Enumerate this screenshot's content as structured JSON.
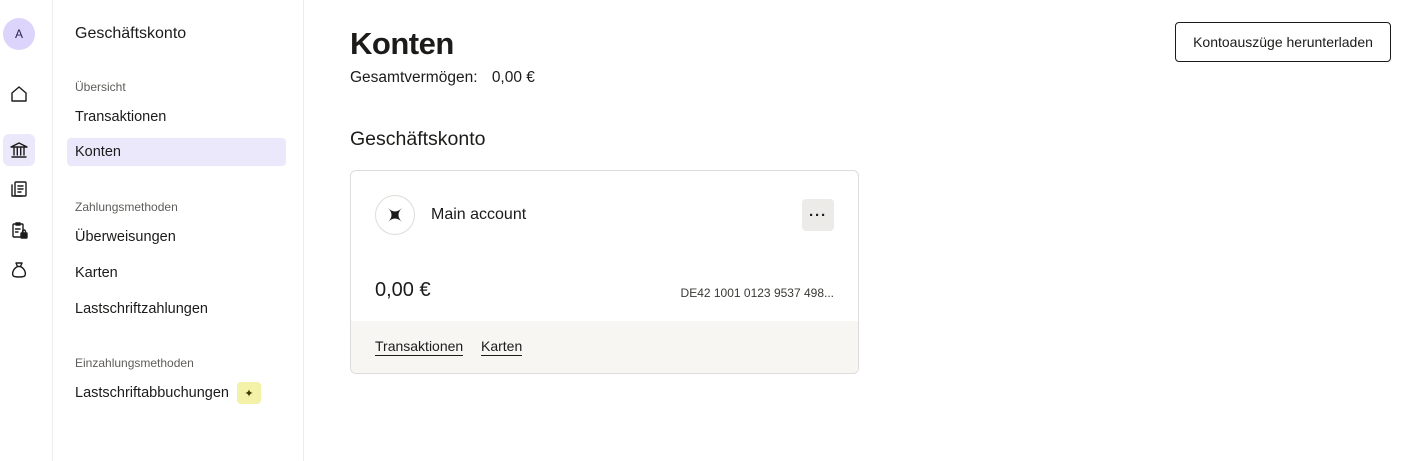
{
  "rail": {
    "avatar_initial": "A",
    "icons": [
      "home-icon",
      "bank-icon",
      "invoice-icon",
      "clipboard-lock-icon",
      "money-bag-icon"
    ],
    "active": "bank-icon"
  },
  "subnav": {
    "title": "Geschäftskonto",
    "groups": [
      {
        "label": "Übersicht",
        "items": [
          "Transaktionen",
          "Konten"
        ]
      },
      {
        "label": "Zahlungsmethoden",
        "items": [
          "Überweisungen",
          "Karten",
          "Lastschriftzahlungen"
        ]
      },
      {
        "label": "Einzahlungsmethoden",
        "items": [
          "Lastschriftabbuchungen"
        ]
      }
    ],
    "active_item": "Konten"
  },
  "header": {
    "title": "Konten",
    "total_label": "Gesamtvermögen:",
    "total_value": "0,00 €",
    "download_label": "Kontoauszüge herunterladen"
  },
  "section": {
    "title": "Geschäftskonto",
    "account": {
      "name": "Main account",
      "more_label": "···",
      "balance": "0,00 €",
      "iban": "DE42 1001 0123 9537 498...",
      "links": [
        "Transaktionen",
        "Karten"
      ]
    }
  },
  "colors": {
    "accent_bg": "#ece8fb",
    "avatar_bg": "#dcd4fb",
    "badge_bg": "#f4f1a8"
  }
}
